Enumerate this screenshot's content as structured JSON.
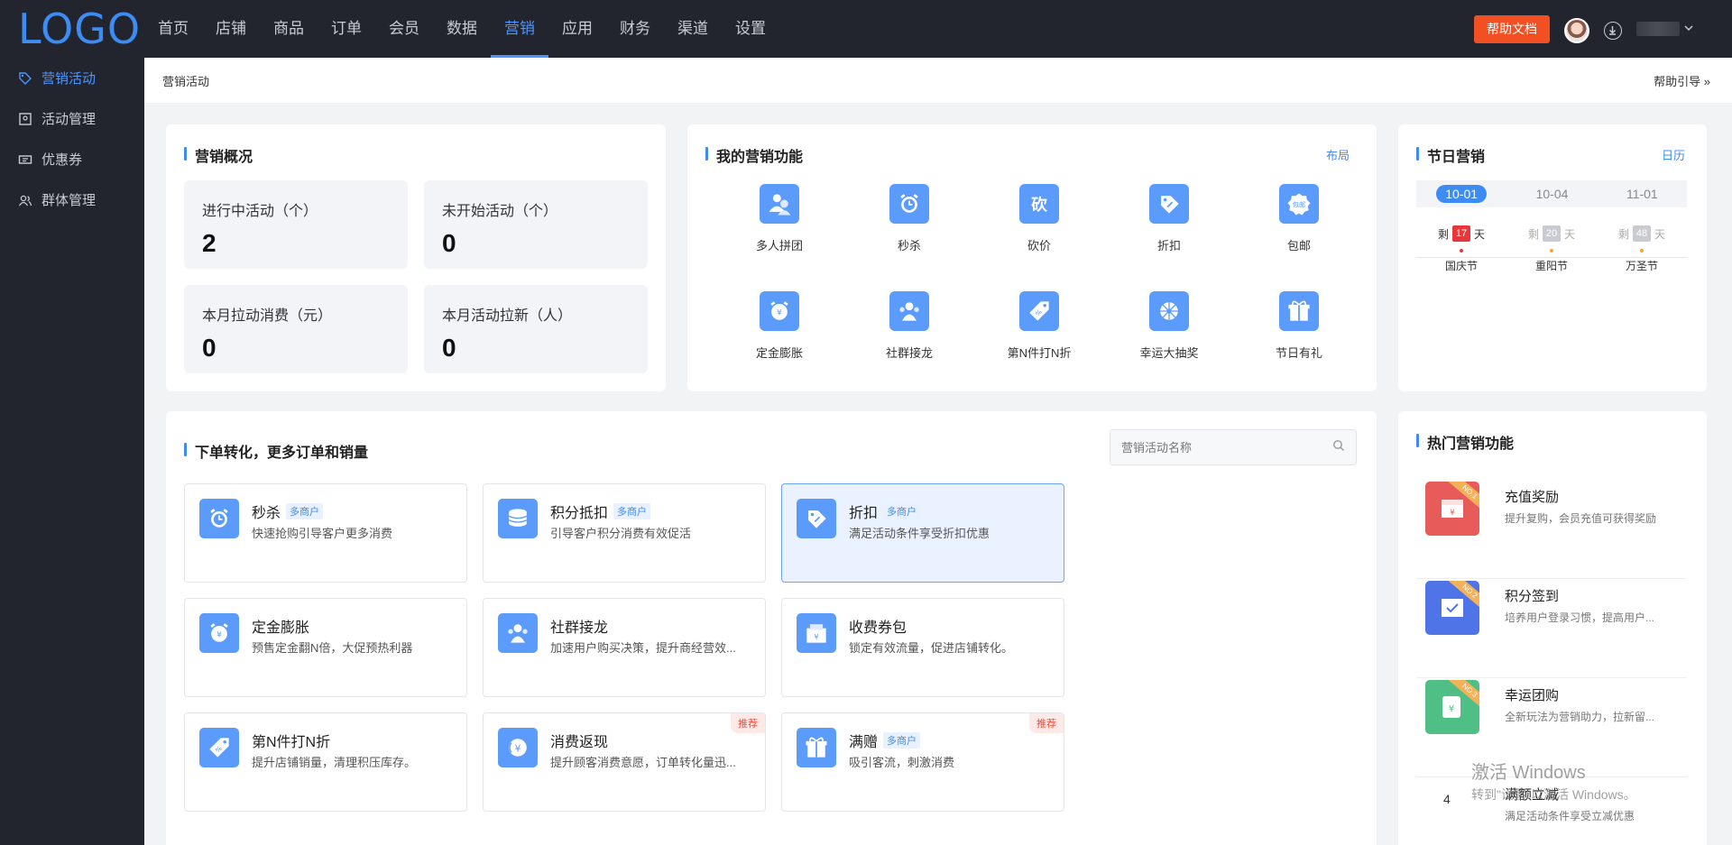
{
  "topbar": {
    "logo": "LOGO",
    "nav": [
      "首页",
      "店铺",
      "商品",
      "订单",
      "会员",
      "数据",
      "营销",
      "应用",
      "财务",
      "渠道",
      "设置"
    ],
    "active_nav": "营销",
    "help_doc": "帮助文档"
  },
  "sidebar": {
    "items": [
      {
        "label": "营销活动",
        "icon": "tag-icon",
        "active": true
      },
      {
        "label": "活动管理",
        "icon": "list-icon",
        "active": false
      },
      {
        "label": "优惠券",
        "icon": "ticket-icon",
        "active": false
      },
      {
        "label": "群体管理",
        "icon": "users-icon",
        "active": false
      }
    ]
  },
  "breadcrumb": "营销活动",
  "help_guide": "帮助引导 »",
  "overview": {
    "title": "营销概况",
    "stats": [
      {
        "label": "进行中活动（个）",
        "value": "2"
      },
      {
        "label": "未开始活动（个）",
        "value": "0"
      },
      {
        "label": "本月拉动消费（元）",
        "value": "0"
      },
      {
        "label": "本月活动拉新（人）",
        "value": "0"
      }
    ]
  },
  "my_features": {
    "title": "我的营销功能",
    "link": "布局",
    "items": [
      {
        "label": "多人拼团",
        "icon": "group-icon"
      },
      {
        "label": "秒杀",
        "icon": "alarm-icon"
      },
      {
        "label": "砍价",
        "icon": "bargain-icon"
      },
      {
        "label": "折扣",
        "icon": "discount-tag-icon"
      },
      {
        "label": "包邮",
        "icon": "free-shipping-icon"
      },
      {
        "label": "定金膨胀",
        "icon": "deposit-icon"
      },
      {
        "label": "社群接龙",
        "icon": "community-icon"
      },
      {
        "label": "第N件打N折",
        "icon": "price-tag-icon"
      },
      {
        "label": "幸运大抽奖",
        "icon": "lottery-icon"
      },
      {
        "label": "节日有礼",
        "icon": "gift-icon"
      }
    ]
  },
  "festival": {
    "title": "节日营销",
    "link": "日历",
    "tabs": [
      "10-01",
      "10-04",
      "11-01"
    ],
    "active_tab": "10-01",
    "prefix": "剩",
    "suffix": "天",
    "items": [
      {
        "days": "17",
        "name": "国庆节",
        "color": "#e8373b",
        "dot": "#e8373b"
      },
      {
        "days": "20",
        "name": "重阳节",
        "color": "#c9cbd0",
        "dot": "#f3a33a"
      },
      {
        "days": "48",
        "name": "万圣节",
        "color": "#c9cbd0",
        "dot": "#f3a33a"
      }
    ]
  },
  "conversion": {
    "title": "下单转化，更多订单和销量",
    "search_placeholder": "营销活动名称",
    "activities": [
      {
        "name": "秒杀",
        "tag": "多商户",
        "desc": "快速抢购引导客户更多消费",
        "badge": "",
        "icon": "alarm-icon"
      },
      {
        "name": "积分抵扣",
        "tag": "多商户",
        "desc": "引导客户积分消费有效促活",
        "badge": "",
        "icon": "coins-icon"
      },
      {
        "name": "折扣",
        "tag": "多商户",
        "desc": "满足活动条件享受折扣优惠",
        "badge": "",
        "icon": "discount-tag-icon"
      },
      {
        "name": "定金膨胀",
        "tag": "",
        "desc": "预售定金翻N倍，大促预热利器",
        "badge": "",
        "icon": "deposit-icon"
      },
      {
        "name": "社群接龙",
        "tag": "",
        "desc": "加速用户购买决策，提升商经营效...",
        "badge": "",
        "icon": "community-icon"
      },
      {
        "name": "收费券包",
        "tag": "",
        "desc": "锁定有效流量，促进店铺转化。",
        "badge": "",
        "icon": "coupon-pack-icon"
      },
      {
        "name": "第N件打N折",
        "tag": "",
        "desc": "提升店铺销量，清理积压库存。",
        "badge": "",
        "icon": "price-tag-icon"
      },
      {
        "name": "消费返现",
        "tag": "",
        "desc": "提升顾客消费意愿，订单转化量迅...",
        "badge": "推荐",
        "icon": "cashback-icon"
      },
      {
        "name": "满赠",
        "tag": "多商户",
        "desc": "吸引客流，刺激消费",
        "badge": "推荐",
        "icon": "gift-icon"
      }
    ]
  },
  "hot": {
    "title": "热门营销功能",
    "items": [
      {
        "name": "充值奖励",
        "desc": "提升复购，会员充值可获得奖励",
        "rank": "NO.1",
        "color": "#e85b5b"
      },
      {
        "name": "积分签到",
        "desc": "培养用户登录习惯，提高用户...",
        "rank": "NO.2",
        "color": "#4f74e8"
      },
      {
        "name": "幸运团购",
        "desc": "全新玩法为营销助力，拉新留...",
        "rank": "NO.3",
        "color": "#4fbf85"
      },
      {
        "name": "满额立减",
        "desc": "满足活动条件享受立减优惠",
        "rank": "4",
        "color": ""
      }
    ]
  },
  "watermark": {
    "line1": "激活 Windows",
    "line2": "转到\"设置\"以激活 Windows。"
  }
}
